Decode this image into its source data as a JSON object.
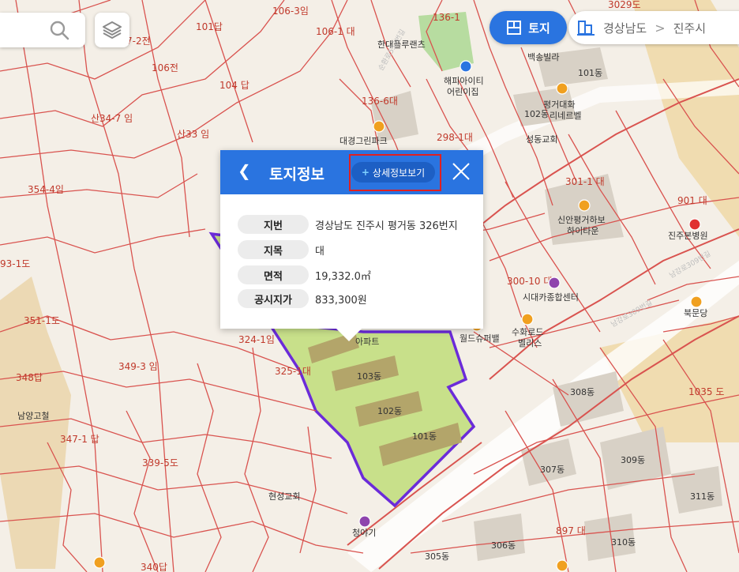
{
  "search": {
    "icon": "search-icon"
  },
  "layers": {
    "icon": "layers-icon"
  },
  "land_toggle": {
    "label": "토지",
    "icon": "land-grid-icon"
  },
  "building_toggle": {
    "icon": "building-icon"
  },
  "region": {
    "province": "경상남도",
    "separator": ">",
    "city": "진주시"
  },
  "popup": {
    "title": "토지정보",
    "detail_label": "상세정보보기",
    "detail_plus": "+",
    "rows": [
      {
        "key": "지번",
        "value": "경상남도 진주시 평거동 326번지"
      },
      {
        "key": "지목",
        "value": "대"
      },
      {
        "key": "면적",
        "value": "19,332.0㎡"
      },
      {
        "key": "공시지가",
        "value": "833,300원"
      }
    ]
  },
  "map_labels": {
    "lot_106_3": "106-3임",
    "lot_106_1": "106-1 대",
    "lot_101": "101답",
    "lot_136_1": "136-1",
    "lot_7_2": "7-2전",
    "lot_106": "106전",
    "lot_104": "104 답",
    "lot_136_6": "136-6대",
    "lot_34_7": "산34-7 임",
    "lot_33": "산33 임",
    "lot_298_1": "298-1대",
    "lot_354_4": "354-4임",
    "lot_301_1": "301-1 대",
    "lot_901": "901 대",
    "lot_93": "93-1도",
    "lot_351": "351-1도",
    "lot_349": "349-3 임",
    "lot_348": "348답",
    "lot_324": "324-1임",
    "lot_325": "325-1대",
    "lot_300": "300-10 대",
    "lot_1035": "1035 도",
    "lot_347": "347-1 답",
    "lot_339": "339-5도",
    "lot_897": "897 대",
    "lot_340": "340답",
    "lot_3029": "3029도",
    "poi_handae": "한대플루랜츠",
    "poi_baekgwang": "백송빌라",
    "poi_pyeonggeo": "평거대화",
    "poi_102": "102동",
    "poi_101": "101동",
    "poi_lanebel": "리네르벨",
    "poi_daegyeong": "대경그린파크",
    "poi_seongdong": "성동교회",
    "poi_happy": "해피아이티",
    "poi_kids": "어린이집",
    "poi_sinan": "신안평거하보",
    "poi_hitown": "하이타운",
    "poi_jinju_hosp": "진주본병원",
    "poi_bukmun": "북문당",
    "poi_sidae": "시대카종합센터",
    "poi_suhwa": "수화로드",
    "poi_dental": "벨리스",
    "poi_world": "월드슈퍼밸",
    "poi_apt": "아파트",
    "b103": "103동",
    "b102": "102동",
    "b101": "101동",
    "b308": "308동",
    "b309": "309동",
    "b307": "307동",
    "b311": "311동",
    "b310": "310동",
    "b306": "306동",
    "b305": "305동",
    "poi_namyang": "남양고철",
    "poi_hyeonseong": "현성교회",
    "poi_cheongya": "청야기",
    "road_1": "순환로553번길",
    "road_2": "남강로309번길",
    "road_3": "남강로309번길"
  },
  "colors": {
    "accent": "#2a74e0",
    "parcel_line": "#d9534f",
    "selected_outline": "#6b2bd9",
    "selected_fill": "#c8e08a"
  }
}
